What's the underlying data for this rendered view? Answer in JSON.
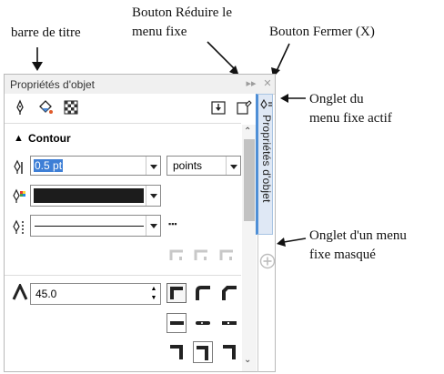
{
  "callouts": {
    "title_bar": "barre de titre",
    "minimize_button_line1": "Bouton Réduire le",
    "minimize_button_line2": "menu fixe",
    "close_button": "Bouton Fermer (X)",
    "active_tab_line1": "Onglet du",
    "active_tab_line2": "menu fixe actif",
    "hidden_tab_line1": "Onglet d'un menu",
    "hidden_tab_line2": "fixe masqué"
  },
  "docker": {
    "title": "Propriétés d'objet",
    "minimize_symbol": "▸▸",
    "close_symbol": "✕",
    "tab_label": "Propriétés d'objet",
    "section_title": "Contour",
    "outline_width_value": "0.5 pt",
    "units_value": "points",
    "outline_color": "#1c1c1c",
    "miter_value": "45.0",
    "more_symbol": "▪▪▪"
  },
  "colors": {
    "active_tab_accent": "#4f8fd6",
    "panel_border": "#b9b9b9"
  }
}
